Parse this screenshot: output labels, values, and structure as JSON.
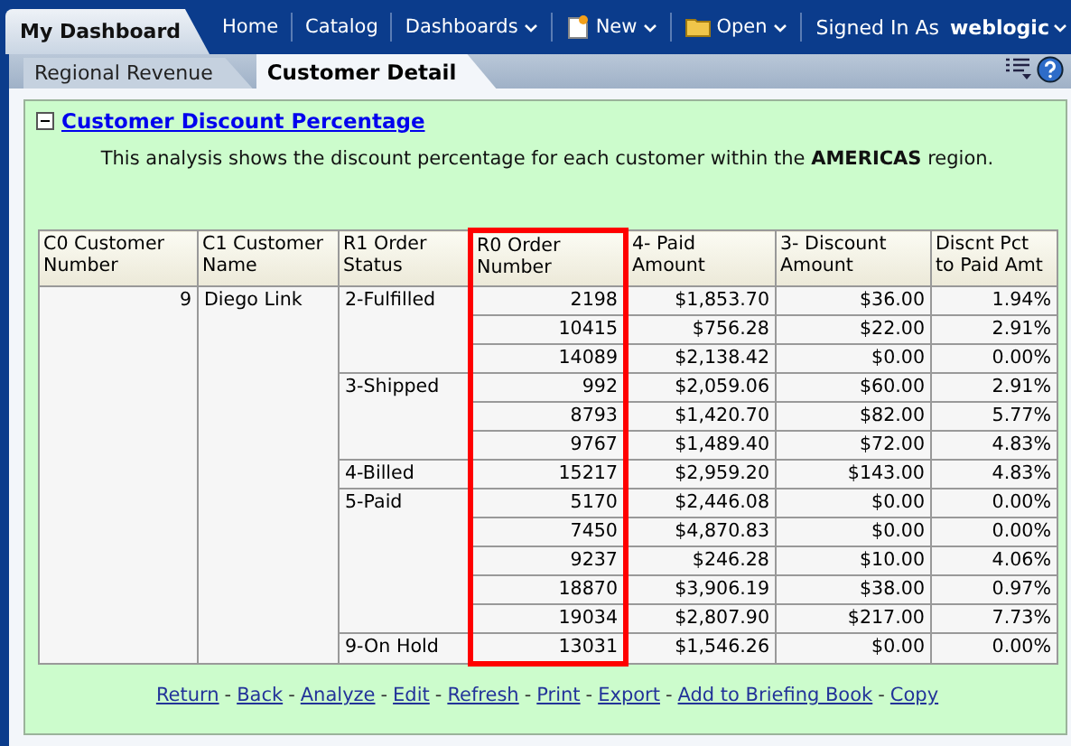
{
  "app_tab": {
    "label": "My Dashboard"
  },
  "nav": [
    {
      "label": "Home",
      "kind": "plain",
      "dropdown": false
    },
    {
      "label": "Catalog",
      "kind": "plain",
      "dropdown": false
    },
    {
      "label": "Dashboards",
      "kind": "plain",
      "dropdown": true
    },
    {
      "label": "New",
      "kind": "create",
      "dropdown": true
    },
    {
      "label": "Open",
      "kind": "open",
      "dropdown": true
    }
  ],
  "user": {
    "label": "Signed In As",
    "name": "weblogic"
  },
  "tabs": [
    {
      "label": "Regional Revenue",
      "selected": false
    },
    {
      "label": "Customer Detail",
      "selected": true
    }
  ],
  "section": {
    "title": "Customer Discount Percentage",
    "expanded": true,
    "description": "This analysis shows the discount percentage for each customer within the **AMERICAS** region."
  },
  "table": {
    "columns": [
      {
        "label": "C0 Customer Number",
        "highlighted": false
      },
      {
        "label": "C1 Customer Name",
        "highlighted": false
      },
      {
        "label": "R1 Order Status",
        "highlighted": false
      },
      {
        "label": "R0 Order Number",
        "highlighted": true
      },
      {
        "label": "4- Paid Amount",
        "highlighted": false
      },
      {
        "label": "3- Discount Amount",
        "highlighted": false
      },
      {
        "label": "Discnt Pct to Paid Amt",
        "highlighted": false
      }
    ],
    "customer_number": "9",
    "customer_name": "Diego Link",
    "groups": [
      {
        "status": "2-Fulfilled",
        "orders": [
          [
            "2198",
            "$1,853.70",
            "$36.00",
            "1.94%"
          ],
          [
            "10415",
            "$756.28",
            "$22.00",
            "2.91%"
          ],
          [
            "14089",
            "$2,138.42",
            "$0.00",
            "0.00%"
          ]
        ]
      },
      {
        "status": "3-Shipped",
        "orders": [
          [
            "992",
            "$2,059.06",
            "$60.00",
            "2.91%"
          ],
          [
            "8793",
            "$1,420.70",
            "$82.00",
            "5.77%"
          ],
          [
            "9767",
            "$1,489.40",
            "$72.00",
            "4.83%"
          ]
        ]
      },
      {
        "status": "4-Billed",
        "orders": [
          [
            "15217",
            "$2,959.20",
            "$143.00",
            "4.83%"
          ]
        ]
      },
      {
        "status": "5-Paid",
        "orders": [
          [
            "5170",
            "$2,446.08",
            "$0.00",
            "0.00%"
          ],
          [
            "7450",
            "$4,870.83",
            "$0.00",
            "0.00%"
          ],
          [
            "9237",
            "$246.28",
            "$10.00",
            "4.06%"
          ],
          [
            "18870",
            "$3,906.19",
            "$38.00",
            "0.97%"
          ],
          [
            "19034",
            "$2,807.90",
            "$217.00",
            "7.73%"
          ]
        ]
      },
      {
        "status": "9-On Hold",
        "orders": [
          [
            "13031",
            "$1,546.26",
            "$0.00",
            "0.00%"
          ]
        ]
      }
    ]
  },
  "links": [
    {
      "label": "Return"
    },
    {
      "separator": "-",
      "label": "Back"
    },
    {
      "separator": "-",
      "label": "Analyze"
    },
    {
      "separator": "-",
      "label": "Edit"
    },
    {
      "separator": "-",
      "label": "Refresh"
    },
    {
      "separator": "-",
      "label": "Print"
    },
    {
      "separator": "-",
      "label": "Export"
    },
    {
      "separator": "-",
      "label": "Add to Briefing Book"
    },
    {
      "separator": "-",
      "label": "Copy"
    }
  ]
}
